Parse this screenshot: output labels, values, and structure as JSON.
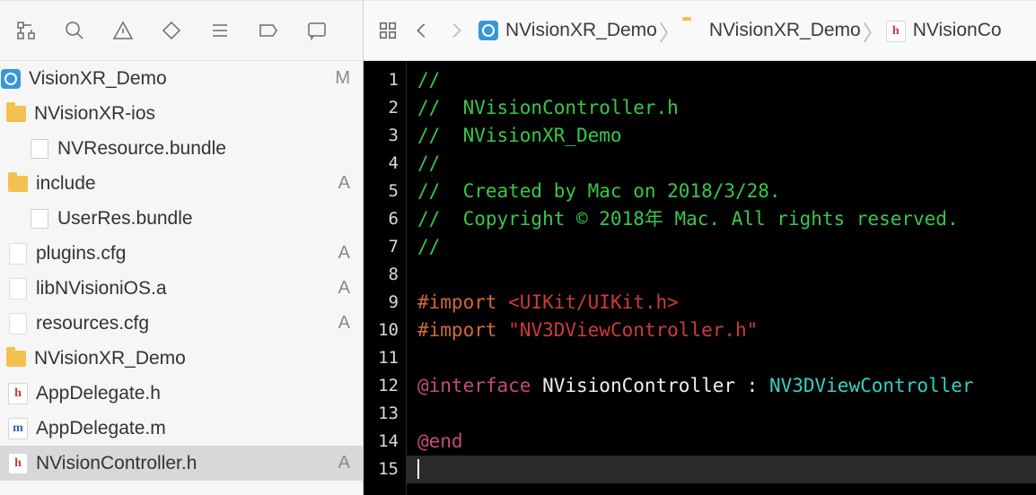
{
  "sidebar": {
    "rows": [
      {
        "label": "VisionXR_Demo",
        "icon": "proj",
        "indent": 0,
        "status": "M",
        "selected": false
      },
      {
        "label": "NVisionXR-ios",
        "icon": "folderyellow",
        "indent": 6,
        "status": "",
        "selected": false
      },
      {
        "label": "NVResource.bundle",
        "icon": "bundle",
        "indent": 32,
        "status": "",
        "selected": false
      },
      {
        "label": "include",
        "icon": "folderyellow",
        "indent": 8,
        "status": "A",
        "selected": false
      },
      {
        "label": "UserRes.bundle",
        "icon": "bundle",
        "indent": 32,
        "status": "",
        "selected": false
      },
      {
        "label": "plugins.cfg",
        "icon": "file",
        "indent": 8,
        "status": "A",
        "selected": false
      },
      {
        "label": "libNVisioniOS.a",
        "icon": "file",
        "indent": 8,
        "status": "A",
        "selected": false
      },
      {
        "label": "resources.cfg",
        "icon": "file",
        "indent": 8,
        "status": "A",
        "selected": false
      },
      {
        "label": "NVisionXR_Demo",
        "icon": "folderyellow",
        "indent": 6,
        "status": "",
        "selected": false
      },
      {
        "label": "AppDelegate.h",
        "icon": "h",
        "indent": 8,
        "status": "",
        "selected": false
      },
      {
        "label": "AppDelegate.m",
        "icon": "m",
        "indent": 8,
        "status": "",
        "selected": false
      },
      {
        "label": "NVisionController.h",
        "icon": "h",
        "indent": 8,
        "status": "A",
        "selected": true
      }
    ]
  },
  "breadcrumb": {
    "items": [
      {
        "label": "NVisionXR_Demo",
        "icon": "proj"
      },
      {
        "label": "NVisionXR_Demo",
        "icon": "folderyellow"
      },
      {
        "label": "NVisionCo",
        "icon": "h"
      }
    ]
  },
  "code": {
    "lines": [
      [
        {
          "cls": "c-comment",
          "text": "//"
        }
      ],
      [
        {
          "cls": "c-comment",
          "text": "//  NVisionController.h"
        }
      ],
      [
        {
          "cls": "c-comment",
          "text": "//  NVisionXR_Demo"
        }
      ],
      [
        {
          "cls": "c-comment",
          "text": "//"
        }
      ],
      [
        {
          "cls": "c-comment",
          "text": "//  Created by Mac on 2018/3/28."
        }
      ],
      [
        {
          "cls": "c-comment",
          "text": "//  Copyright © 2018年 Mac. All rights reserved."
        }
      ],
      [
        {
          "cls": "c-comment",
          "text": "//"
        }
      ],
      [
        {
          "cls": "c-plain",
          "text": ""
        }
      ],
      [
        {
          "cls": "c-pp",
          "text": "#import "
        },
        {
          "cls": "c-str",
          "text": "<UIKit/UIKit.h>"
        }
      ],
      [
        {
          "cls": "c-pp",
          "text": "#import "
        },
        {
          "cls": "c-str",
          "text": "\"NV3DViewController.h\""
        }
      ],
      [
        {
          "cls": "c-plain",
          "text": ""
        }
      ],
      [
        {
          "cls": "c-kw",
          "text": "@interface"
        },
        {
          "cls": "c-plain",
          "text": " NVisionController : "
        },
        {
          "cls": "c-type",
          "text": "NV3DViewController"
        }
      ],
      [
        {
          "cls": "c-plain",
          "text": ""
        }
      ],
      [
        {
          "cls": "c-kw",
          "text": "@end"
        }
      ],
      [
        {
          "cls": "c-plain",
          "text": ""
        }
      ]
    ],
    "cursor_line": 15
  }
}
